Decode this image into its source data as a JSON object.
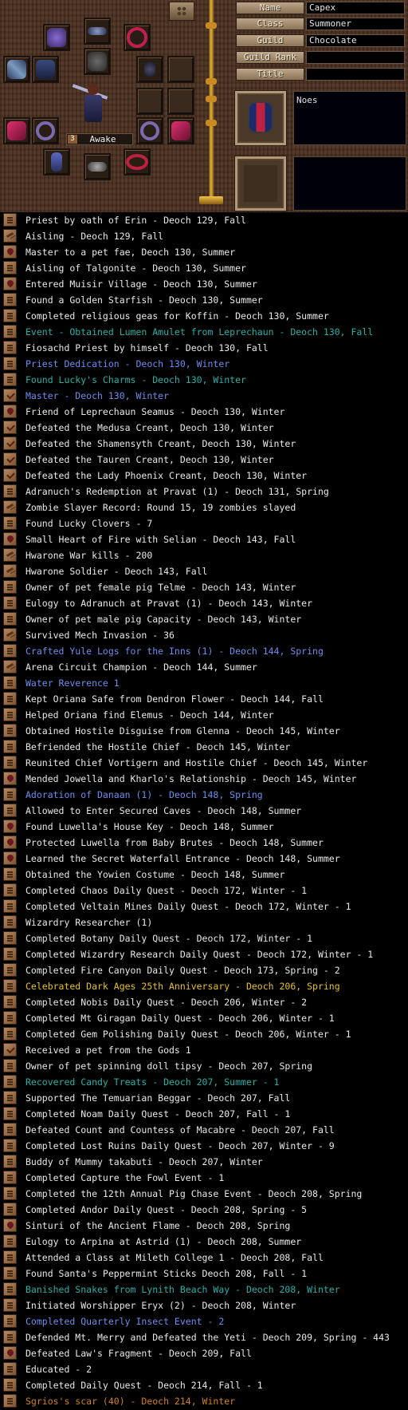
{
  "equipment": {
    "status_number": "3",
    "status_label": "Awake",
    "slots": [
      {
        "icon": "amulet-icon",
        "color": "#6a4aa8"
      },
      {
        "icon": "feather-icon",
        "color": "#5a6a9a"
      },
      {
        "icon": "necklace-icon",
        "color": "#b02048"
      },
      {
        "icon": "weapon-icon",
        "color": "#5a7aa0"
      },
      {
        "icon": "armor-icon",
        "color": "#2a3a6a"
      },
      {
        "icon": "helmet-icon",
        "color": "#4a4a4a"
      },
      {
        "icon": "earring-icon",
        "color": "#3a3a5a"
      },
      {
        "icon": "staff-icon",
        "color": "#a0a0c0"
      },
      {
        "icon": "gauntlet-icon",
        "color": "#c02060"
      },
      {
        "icon": "ring-icon",
        "color": "#6a5aa0"
      },
      {
        "icon": "ring-icon",
        "color": "#6a5aa0"
      },
      {
        "icon": "gauntlet-icon",
        "color": "#c02060"
      },
      {
        "icon": "boots-icon",
        "color": "#4a5aa8"
      },
      {
        "icon": "accessory-icon",
        "color": "#8a8a8a"
      },
      {
        "icon": "belt-icon",
        "color": "#b02040"
      }
    ],
    "portrait_icon": "pixel-avatar-icon"
  },
  "profile": {
    "fields": [
      {
        "label": "Name",
        "value": "Capex"
      },
      {
        "label": "Class",
        "value": "Summoner"
      },
      {
        "label": "Guild",
        "value": "Chocolate"
      },
      {
        "label": "Guild Rank",
        "value": ""
      },
      {
        "label": "Title",
        "value": ""
      }
    ],
    "emblem_icon": "clan-emblem-icon",
    "profile_text": "Noes",
    "bottom_text": ""
  },
  "legend": [
    {
      "icon": "scroll",
      "color": "white",
      "text": "Priest by oath of Erin - Deoch 129, Fall"
    },
    {
      "icon": "hammer",
      "color": "white",
      "text": "Aisling - Deoch 129, Fall"
    },
    {
      "icon": "heart",
      "color": "white",
      "text": "Master to a pet fae, Deoch 130, Summer"
    },
    {
      "icon": "scroll",
      "color": "white",
      "text": "Aisling of Talgonite - Deoch 130, Summer"
    },
    {
      "icon": "heart",
      "color": "white",
      "text": "Entered Muisir Village - Deoch 130, Summer"
    },
    {
      "icon": "scroll",
      "color": "white",
      "text": "Found a Golden Starfish - Deoch 130, Summer"
    },
    {
      "icon": "scroll",
      "color": "white",
      "text": "Completed religious geas for Koffin - Deoch 130, Summer"
    },
    {
      "icon": "scroll",
      "color": "teal",
      "text": "Event - Obtained Lumen Amulet from Leprechaun - Deoch 130, Fall"
    },
    {
      "icon": "scroll",
      "color": "white",
      "text": "Fiosachd Priest by himself - Deoch 130, Fall"
    },
    {
      "icon": "scroll",
      "color": "blue",
      "text": "Priest Dedication - Deoch 130, Winter"
    },
    {
      "icon": "scroll",
      "color": "teal",
      "text": "Found Lucky's Charms - Deoch 130, Winter"
    },
    {
      "icon": "check",
      "color": "blue",
      "text": "Master - Deoch 130, Winter"
    },
    {
      "icon": "heart",
      "color": "white",
      "text": "Friend of Leprechaun Seamus - Deoch 130, Winter"
    },
    {
      "icon": "check",
      "color": "white",
      "text": "Defeated the Medusa Creant, Deoch 130, Winter"
    },
    {
      "icon": "check",
      "color": "white",
      "text": "Defeated the Shamensyth Creant, Deoch 130, Winter"
    },
    {
      "icon": "check",
      "color": "white",
      "text": "Defeated the Tauren Creant, Deoch 130, Winter"
    },
    {
      "icon": "check",
      "color": "white",
      "text": "Defeated the Lady Phoenix Creant, Deoch 130, Winter"
    },
    {
      "icon": "scroll",
      "color": "white",
      "text": "Adranuch's Redemption at Pravat (1) - Deoch 131, Spring"
    },
    {
      "icon": "hammer",
      "color": "white",
      "text": "Zombie Slayer Record: Round 15, 19 zombies slayed"
    },
    {
      "icon": "scroll",
      "color": "white",
      "text": "Found Lucky Clovers - 7"
    },
    {
      "icon": "heart",
      "color": "white",
      "text": "Small Heart of Fire with Selian - Deoch 143, Fall"
    },
    {
      "icon": "hammer",
      "color": "white",
      "text": "Hwarone War kills - 200"
    },
    {
      "icon": "hammer",
      "color": "white",
      "text": "Hwarone Soldier - Deoch 143, Fall"
    },
    {
      "icon": "scroll",
      "color": "white",
      "text": "Owner of pet female pig Telme - Deoch 143, Winter"
    },
    {
      "icon": "scroll",
      "color": "white",
      "text": "Eulogy to Adranuch at Pravat (1) - Deoch 143, Winter"
    },
    {
      "icon": "scroll",
      "color": "white",
      "text": "Owner of pet male pig Capacity - Deoch 143, Winter"
    },
    {
      "icon": "hammer",
      "color": "white",
      "text": "Survived Mech Invasion - 36"
    },
    {
      "icon": "scroll",
      "color": "blue",
      "text": "Crafted Yule Logs for the Inns (1) - Deoch 144, Spring"
    },
    {
      "icon": "hammer",
      "color": "white",
      "text": "Arena Circuit Champion - Deoch 144, Summer"
    },
    {
      "icon": "scroll",
      "color": "blue",
      "text": "Water Reverence 1"
    },
    {
      "icon": "scroll",
      "color": "white",
      "text": "Kept Oriana Safe from Dendron Flower - Deoch 144, Fall"
    },
    {
      "icon": "scroll",
      "color": "white",
      "text": "Helped Oriana find Elemus - Deoch 144, Winter"
    },
    {
      "icon": "scroll",
      "color": "white",
      "text": "Obtained Hostile Disguise from Glenna - Deoch 145, Winter"
    },
    {
      "icon": "scroll",
      "color": "white",
      "text": "Befriended the Hostile Chief - Deoch 145, Winter"
    },
    {
      "icon": "scroll",
      "color": "white",
      "text": "Reunited Chief Vortigern and Hostile Chief - Deoch 145, Winter"
    },
    {
      "icon": "heart",
      "color": "white",
      "text": "Mended Jowella and Kharlo's Relationship - Deoch 145, Winter"
    },
    {
      "icon": "scroll",
      "color": "blue",
      "text": "Adoration of Danaan (1) - Deoch 148, Spring"
    },
    {
      "icon": "scroll",
      "color": "white",
      "text": "Allowed to Enter Secured Caves - Deoch 148, Summer"
    },
    {
      "icon": "heart",
      "color": "white",
      "text": "Found Luwella's House Key - Deoch 148, Summer"
    },
    {
      "icon": "heart",
      "color": "white",
      "text": "Protected Luwella from Baby Brutes - Deoch 148, Summer"
    },
    {
      "icon": "heart",
      "color": "white",
      "text": "Learned the Secret Waterfall Entrance - Deoch 148, Summer"
    },
    {
      "icon": "scroll",
      "color": "white",
      "text": "Obtained the Yowien Costume - Deoch 148, Summer"
    },
    {
      "icon": "scroll",
      "color": "white",
      "text": "Completed Chaos Daily Quest - Deoch 172, Winter - 1"
    },
    {
      "icon": "scroll",
      "color": "white",
      "text": "Completed Veltain Mines Daily Quest - Deoch 172, Winter - 1"
    },
    {
      "icon": "scroll",
      "color": "white",
      "text": "Wizardry Researcher (1)"
    },
    {
      "icon": "scroll",
      "color": "white",
      "text": "Completed Botany Daily Quest - Deoch 172, Winter - 1"
    },
    {
      "icon": "scroll",
      "color": "white",
      "text": "Completed Wizardry Research Daily Quest - Deoch 172, Winter - 1"
    },
    {
      "icon": "scroll",
      "color": "white",
      "text": "Completed Fire Canyon Daily Quest - Deoch 173, Spring - 2"
    },
    {
      "icon": "scroll",
      "color": "yellow",
      "text": "Celebrated Dark Ages 25th Anniversary - Deoch 206, Spring"
    },
    {
      "icon": "scroll",
      "color": "white",
      "text": "Completed Nobis Daily Quest - Deoch 206, Winter - 2"
    },
    {
      "icon": "scroll",
      "color": "white",
      "text": "Completed Mt Giragan Daily Quest - Deoch 206, Winter - 1"
    },
    {
      "icon": "scroll",
      "color": "white",
      "text": "Completed Gem Polishing Daily Quest - Deoch 206, Winter - 1"
    },
    {
      "icon": "check",
      "color": "white",
      "text": "Received a pet from the Gods 1"
    },
    {
      "icon": "scroll",
      "color": "white",
      "text": "Owner of pet spinning doll tipsy - Deoch 207, Spring"
    },
    {
      "icon": "scroll",
      "color": "teal",
      "text": "Recovered Candy Treats - Deoch 207, Summer - 1"
    },
    {
      "icon": "scroll",
      "color": "white",
      "text": "Supported The Temuarian Beggar - Deoch 207, Fall"
    },
    {
      "icon": "scroll",
      "color": "white",
      "text": "Completed Noam Daily Quest - Deoch 207, Fall - 1"
    },
    {
      "icon": "scroll",
      "color": "white",
      "text": "Defeated Count and Countess of Macabre - Deoch 207, Fall"
    },
    {
      "icon": "scroll",
      "color": "white",
      "text": "Completed Lost Ruins Daily Quest - Deoch 207, Winter - 9"
    },
    {
      "icon": "scroll",
      "color": "white",
      "text": "Buddy of Mummy takabuti - Deoch 207, Winter"
    },
    {
      "icon": "scroll",
      "color": "white",
      "text": "Completed Capture the Fowl Event - 1"
    },
    {
      "icon": "scroll",
      "color": "white",
      "text": "Completed the 12th Annual Pig Chase Event - Deoch 208, Spring"
    },
    {
      "icon": "scroll",
      "color": "white",
      "text": "Completed Andor Daily Quest - Deoch 208, Spring - 5"
    },
    {
      "icon": "heart",
      "color": "white",
      "text": "Sinturi of the Ancient Flame - Deoch 208, Spring"
    },
    {
      "icon": "scroll",
      "color": "white",
      "text": "Eulogy to Arpina at Astrid (1) - Deoch 208, Summer"
    },
    {
      "icon": "scroll",
      "color": "white",
      "text": "Attended a Class at Mileth College 1 - Deoch 208, Fall"
    },
    {
      "icon": "scroll",
      "color": "white",
      "text": "Found Santa's Peppermint Sticks  Deoch 208, Fall - 1"
    },
    {
      "icon": "scroll",
      "color": "teal",
      "text": "Banished Snakes from Lynith Beach Way - Deoch 208, Winter"
    },
    {
      "icon": "scroll",
      "color": "white",
      "text": "Initiated Worshipper Eryx (2) - Deoch 208, Winter"
    },
    {
      "icon": "scroll",
      "color": "blue",
      "text": "Completed Quarterly Insect Event - 2"
    },
    {
      "icon": "scroll",
      "color": "white",
      "text": "Defended Mt. Merry and Defeated the Yeti - Deoch 209, Spring - 443"
    },
    {
      "icon": "heart",
      "color": "white",
      "text": "Defeated Law's Fragment - Deoch 209, Fall"
    },
    {
      "icon": "scroll",
      "color": "white",
      "text": "Educated - 2"
    },
    {
      "icon": "scroll",
      "color": "white",
      "text": "Completed Daily Quest - Deoch 214, Fall - 1"
    },
    {
      "icon": "scroll",
      "color": "orange",
      "text": "Sgrios's scar (40) - Deoch 214, Winter"
    }
  ]
}
